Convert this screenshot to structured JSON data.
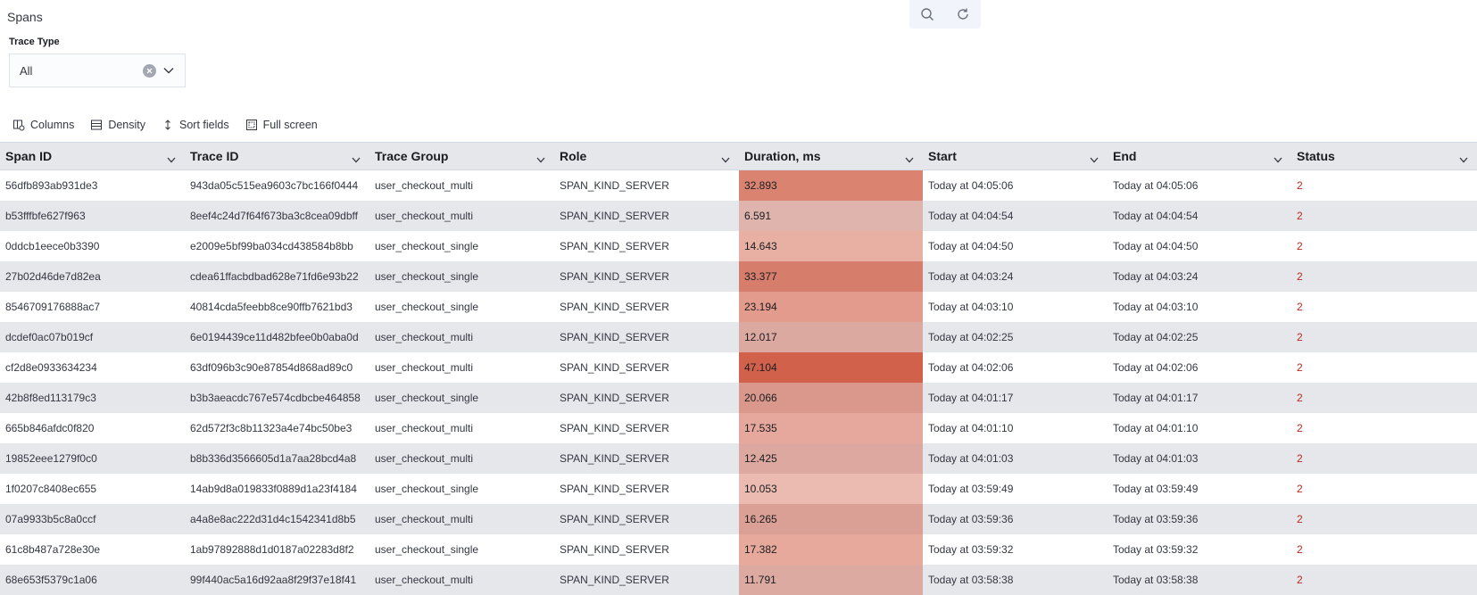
{
  "panel": {
    "title": "Spans"
  },
  "top_toolbar": {
    "icons": [
      "search-icon",
      "refresh-icon"
    ]
  },
  "trace_type": {
    "label": "Trace Type",
    "value": "All"
  },
  "grid_toolbar": {
    "columns": "Columns",
    "density": "Density",
    "sort_fields": "Sort fields",
    "full_screen": "Full screen"
  },
  "columns": [
    "Span ID",
    "Trace ID",
    "Trace Group",
    "Role",
    "Duration, ms",
    "Start",
    "End",
    "Status"
  ],
  "colors": {
    "status_error": "#bd271e",
    "header_bg": "#e6e7ea",
    "duration_heat": "#d1614a"
  },
  "rows": [
    {
      "span_id": "56dfb893ab931de3",
      "trace_id": "943da05c515ea9603c7bc166f0444",
      "trace_group": "user_checkout_multi",
      "role": "SPAN_KIND_SERVER",
      "duration": "32.893",
      "start": "Today at 04:05:06",
      "end": "Today at 04:05:06",
      "status": "2"
    },
    {
      "span_id": "b53fffbfe627f963",
      "trace_id": "8eef4c24d7f64f673ba3c8cea09dbff",
      "trace_group": "user_checkout_multi",
      "role": "SPAN_KIND_SERVER",
      "duration": "6.591",
      "start": "Today at 04:04:54",
      "end": "Today at 04:04:54",
      "status": "2"
    },
    {
      "span_id": "0ddcb1eece0b3390",
      "trace_id": "e2009e5bf99ba034cd438584b8bb",
      "trace_group": "user_checkout_single",
      "role": "SPAN_KIND_SERVER",
      "duration": "14.643",
      "start": "Today at 04:04:50",
      "end": "Today at 04:04:50",
      "status": "2"
    },
    {
      "span_id": "27b02d46de7d82ea",
      "trace_id": "cdea61ffacbdbad628e71fd6e93b22",
      "trace_group": "user_checkout_single",
      "role": "SPAN_KIND_SERVER",
      "duration": "33.377",
      "start": "Today at 04:03:24",
      "end": "Today at 04:03:24",
      "status": "2"
    },
    {
      "span_id": "8546709176888ac7",
      "trace_id": "40814cda5feebb8ce90ffb7621bd3",
      "trace_group": "user_checkout_single",
      "role": "SPAN_KIND_SERVER",
      "duration": "23.194",
      "start": "Today at 04:03:10",
      "end": "Today at 04:03:10",
      "status": "2"
    },
    {
      "span_id": "dcdef0ac07b019cf",
      "trace_id": "6e0194439ce11d482bfee0b0aba0d",
      "trace_group": "user_checkout_multi",
      "role": "SPAN_KIND_SERVER",
      "duration": "12.017",
      "start": "Today at 04:02:25",
      "end": "Today at 04:02:25",
      "status": "2"
    },
    {
      "span_id": "cf2d8e0933634234",
      "trace_id": "63df096b3c90e87854d868ad89c0",
      "trace_group": "user_checkout_multi",
      "role": "SPAN_KIND_SERVER",
      "duration": "47.104",
      "start": "Today at 04:02:06",
      "end": "Today at 04:02:06",
      "status": "2"
    },
    {
      "span_id": "42b8f8ed113179c3",
      "trace_id": "b3b3aeacdc767e574cdbcbe464858",
      "trace_group": "user_checkout_single",
      "role": "SPAN_KIND_SERVER",
      "duration": "20.066",
      "start": "Today at 04:01:17",
      "end": "Today at 04:01:17",
      "status": "2"
    },
    {
      "span_id": "665b846afdc0f820",
      "trace_id": "62d572f3c8b11323a4e74bc50be3",
      "trace_group": "user_checkout_multi",
      "role": "SPAN_KIND_SERVER",
      "duration": "17.535",
      "start": "Today at 04:01:10",
      "end": "Today at 04:01:10",
      "status": "2"
    },
    {
      "span_id": "19852eee1279f0c0",
      "trace_id": "b8b336d3566605d1a7aa28bcd4a8",
      "trace_group": "user_checkout_multi",
      "role": "SPAN_KIND_SERVER",
      "duration": "12.425",
      "start": "Today at 04:01:03",
      "end": "Today at 04:01:03",
      "status": "2"
    },
    {
      "span_id": "1f0207c8408ec655",
      "trace_id": "14ab9d8a019833f0889d1a23f4184",
      "trace_group": "user_checkout_single",
      "role": "SPAN_KIND_SERVER",
      "duration": "10.053",
      "start": "Today at 03:59:49",
      "end": "Today at 03:59:49",
      "status": "2"
    },
    {
      "span_id": "07a9933b5c8a0ccf",
      "trace_id": "a4a8e8ac222d31d4c1542341d8b5",
      "trace_group": "user_checkout_multi",
      "role": "SPAN_KIND_SERVER",
      "duration": "16.265",
      "start": "Today at 03:59:36",
      "end": "Today at 03:59:36",
      "status": "2"
    },
    {
      "span_id": "61c8b487a728e30e",
      "trace_id": "1ab97892888d1d0187a02283d8f2",
      "trace_group": "user_checkout_single",
      "role": "SPAN_KIND_SERVER",
      "duration": "17.382",
      "start": "Today at 03:59:32",
      "end": "Today at 03:59:32",
      "status": "2"
    },
    {
      "span_id": "68e653f5379c1a06",
      "trace_id": "99f440ac5a16d92aa8f29f37e18f41",
      "trace_group": "user_checkout_multi",
      "role": "SPAN_KIND_SERVER",
      "duration": "11.791",
      "start": "Today at 03:58:38",
      "end": "Today at 03:58:38",
      "status": "2"
    }
  ]
}
